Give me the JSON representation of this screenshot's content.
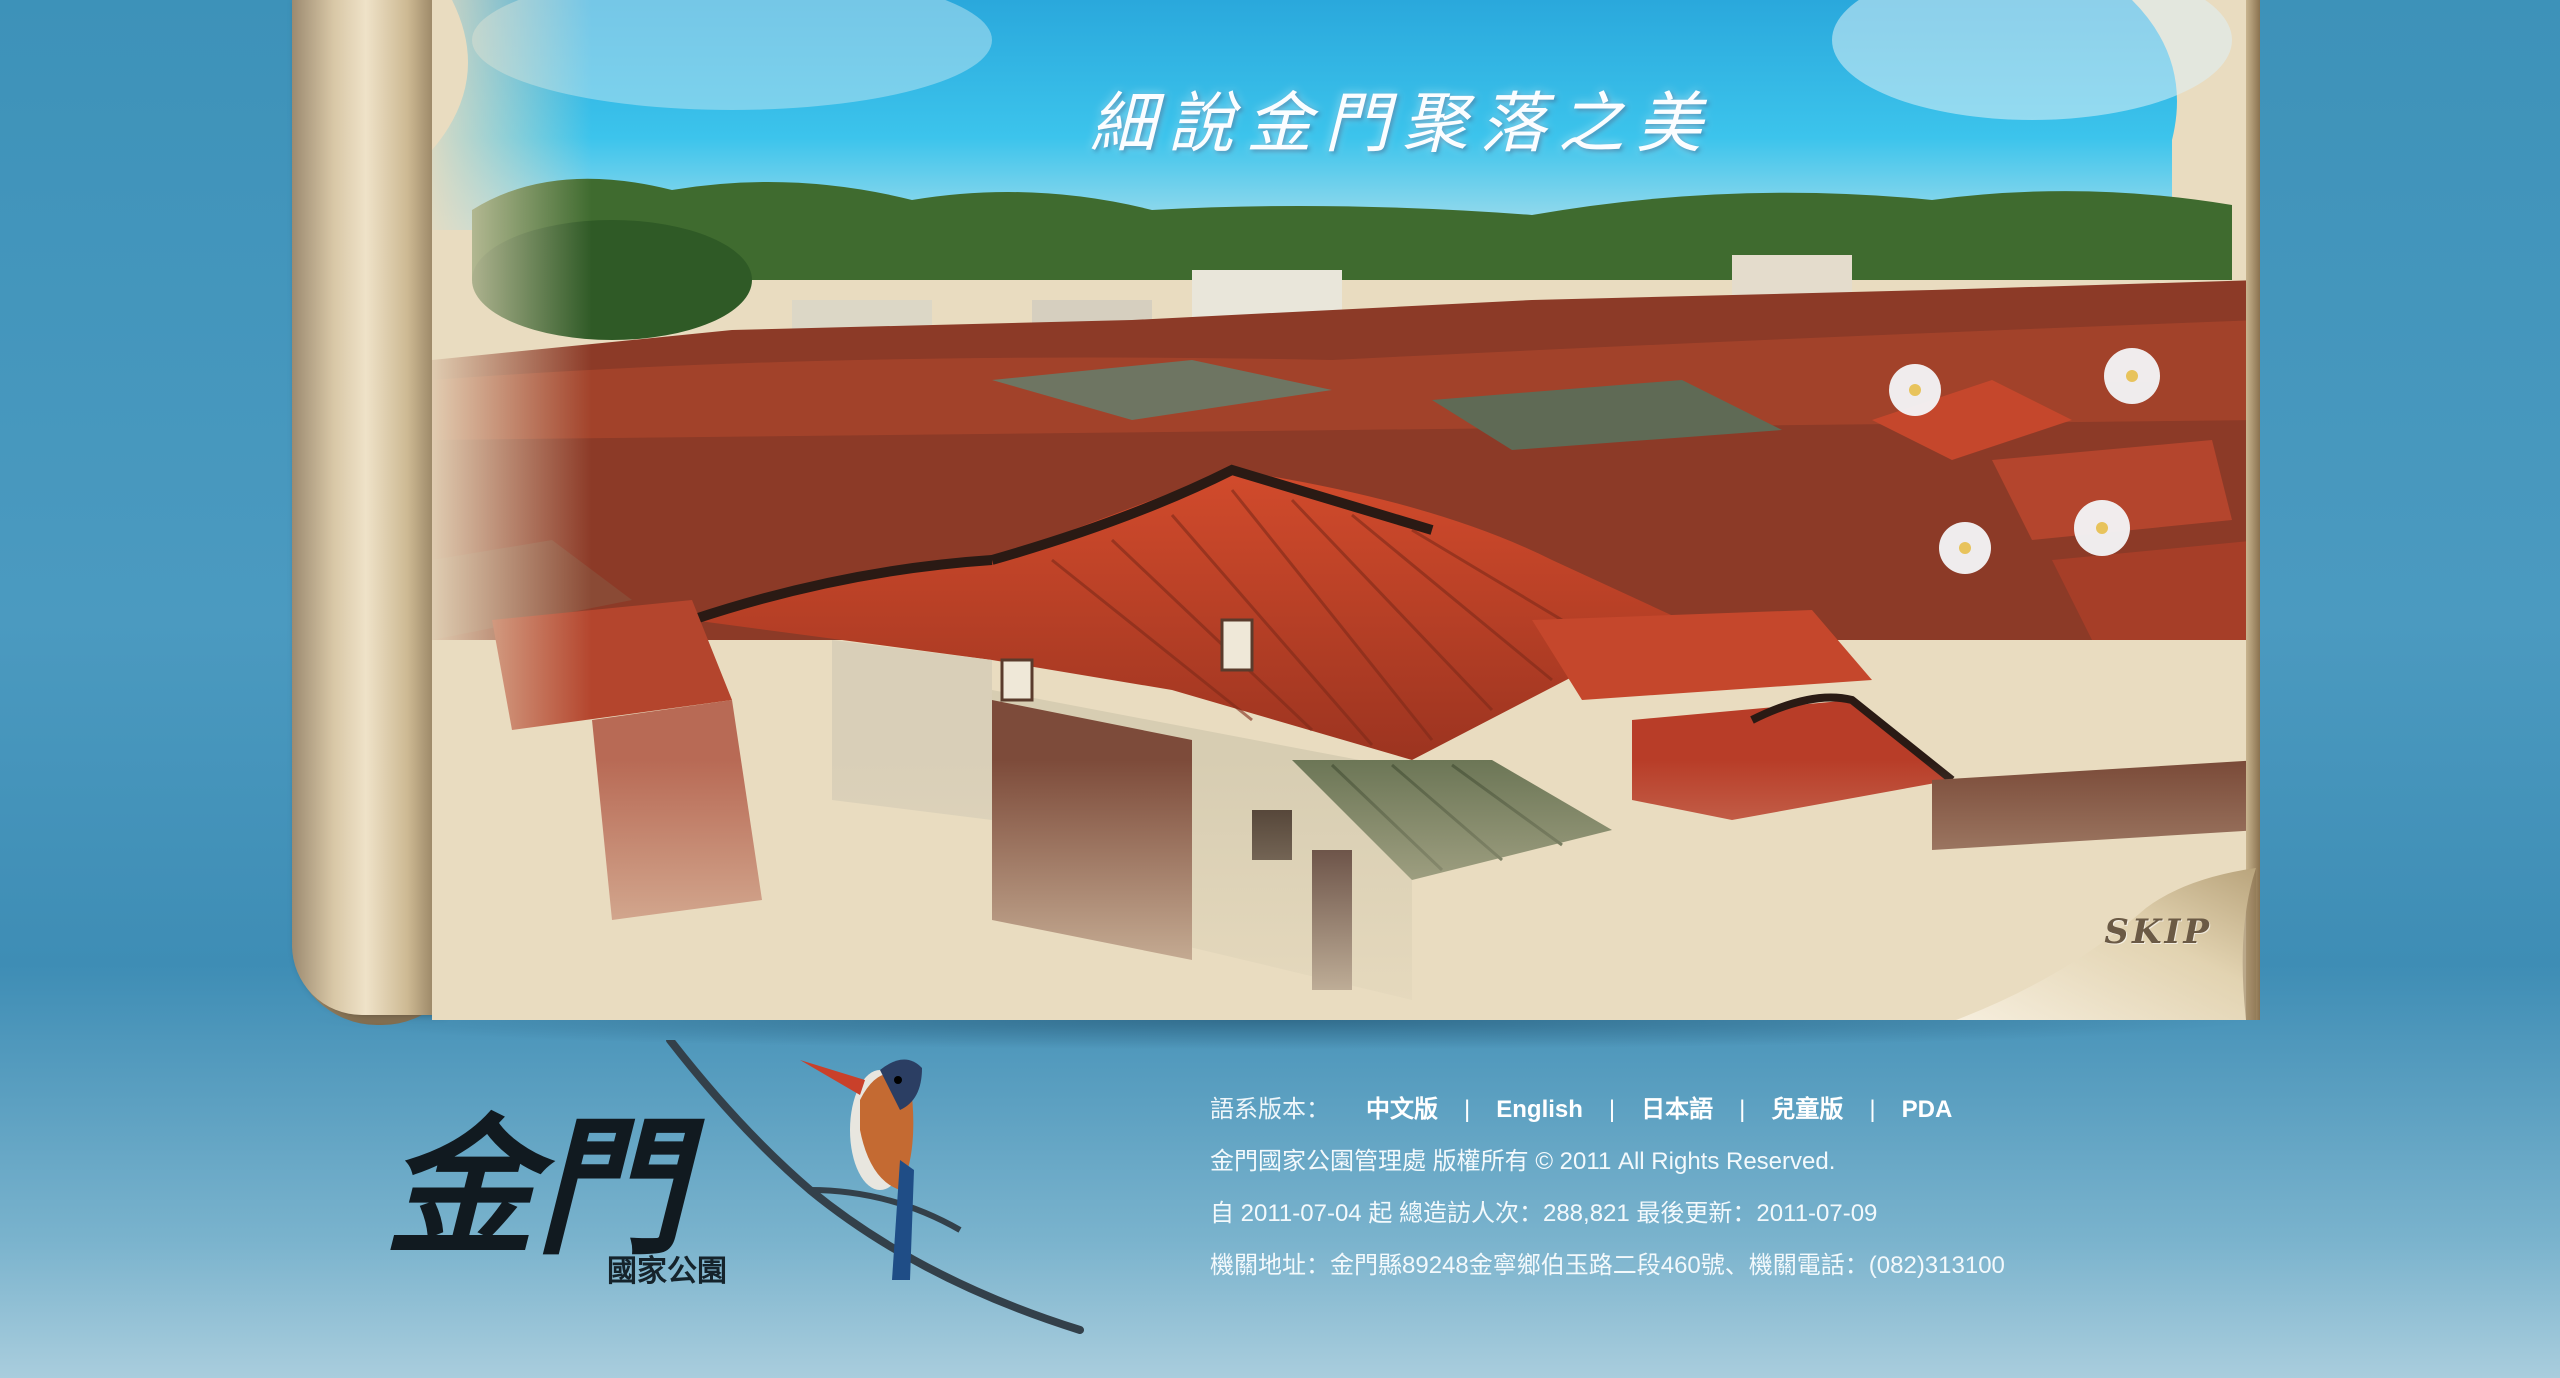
{
  "banner": {
    "title": "細說金門聚落之美",
    "skip_label": "SKIP"
  },
  "logo": {
    "main_text": "金門",
    "sub_text": "國家公園"
  },
  "footer": {
    "language_label": "語系版本：",
    "languages": [
      "中文版",
      "English",
      "日本語",
      "兒童版",
      "PDA"
    ],
    "separator": "|",
    "copyright": "金門國家公園管理處 版權所有 © 2011 All Rights Reserved.",
    "stats": "自 2011-07-04 起 總造訪人次：288,821 最後更新：2011-07-09",
    "address": "機關地址：金門縣89248金寧鄉伯玉路二段460號、機關電話：(082)313100"
  },
  "colors": {
    "background": "#3d92b9",
    "roof": "#b8412a",
    "sky": "#26b4e4",
    "page": "#e9dcc0"
  }
}
